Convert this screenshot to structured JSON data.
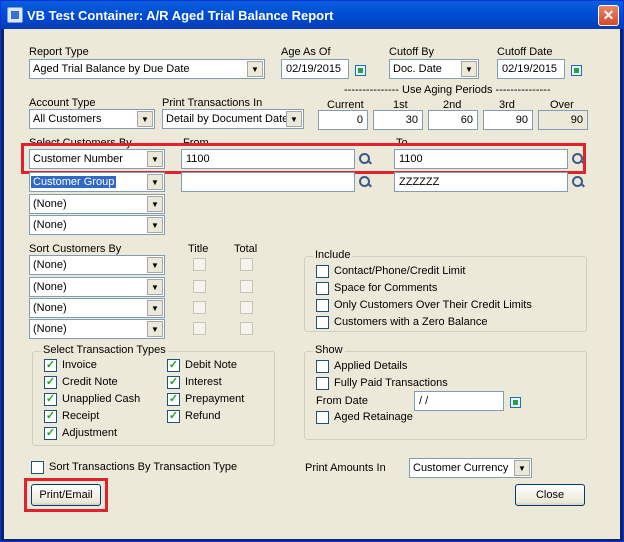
{
  "window": {
    "title": "VB Test Container: A/R Aged Trial Balance Report",
    "close_glyph": "✕"
  },
  "report_type": {
    "label": "Report Type",
    "value": "Aged Trial Balance by Due Date"
  },
  "age_as_of": {
    "label": "Age As Of",
    "value": "02/19/2015"
  },
  "cutoff_by": {
    "label": "Cutoff By",
    "value": "Doc. Date"
  },
  "cutoff_date": {
    "label": "Cutoff Date",
    "value": "02/19/2015"
  },
  "account_type": {
    "label": "Account Type",
    "value": "All Customers"
  },
  "print_transactions_in": {
    "label": "Print Transactions In",
    "value": "Detail by Document Date"
  },
  "aging": {
    "header": "--------------- Use Aging Periods ---------------",
    "columns": [
      "Current",
      "1st",
      "2nd",
      "3rd",
      "Over"
    ],
    "values": [
      "0",
      "30",
      "60",
      "90",
      "90"
    ]
  },
  "select_customers": {
    "label": "Select Customers By",
    "from_label": "From",
    "to_label": "To",
    "rows": [
      {
        "field": "Customer Number",
        "from": "1100",
        "to": "1100"
      },
      {
        "field": "Customer Group",
        "from": "",
        "to": "ZZZZZZ"
      },
      {
        "field": "(None)"
      },
      {
        "field": "(None)"
      }
    ]
  },
  "sort_customers": {
    "label": "Sort Customers By",
    "title_label": "Title",
    "total_label": "Total",
    "rows": [
      "(None)",
      "(None)",
      "(None)",
      "(None)"
    ]
  },
  "include": {
    "label": "Include",
    "items": [
      {
        "label": "Contact/Phone/Credit Limit",
        "checked": false
      },
      {
        "label": "Space for Comments",
        "checked": false
      },
      {
        "label": "Only Customers Over Their Credit Limits",
        "checked": false
      },
      {
        "label": "Customers with a Zero Balance",
        "checked": false
      }
    ]
  },
  "transaction_types": {
    "label": "Select Transaction Types",
    "items": [
      "Invoice",
      "Credit Note",
      "Unapplied Cash",
      "Receipt",
      "Adjustment",
      "Debit Note",
      "Interest",
      "Prepayment",
      "Refund"
    ]
  },
  "show": {
    "label": "Show",
    "applied_details": "Applied Details",
    "fully_paid": "Fully Paid Transactions",
    "from_date_label": "From Date",
    "from_date_value": "/ /",
    "aged_retainage": "Aged Retainage"
  },
  "sort_by_type": {
    "label": "Sort Transactions By Transaction Type"
  },
  "print_amounts_in": {
    "label": "Print Amounts In",
    "value": "Customer Currency"
  },
  "buttons": {
    "print_email": "Print/Email",
    "close": "Close"
  }
}
